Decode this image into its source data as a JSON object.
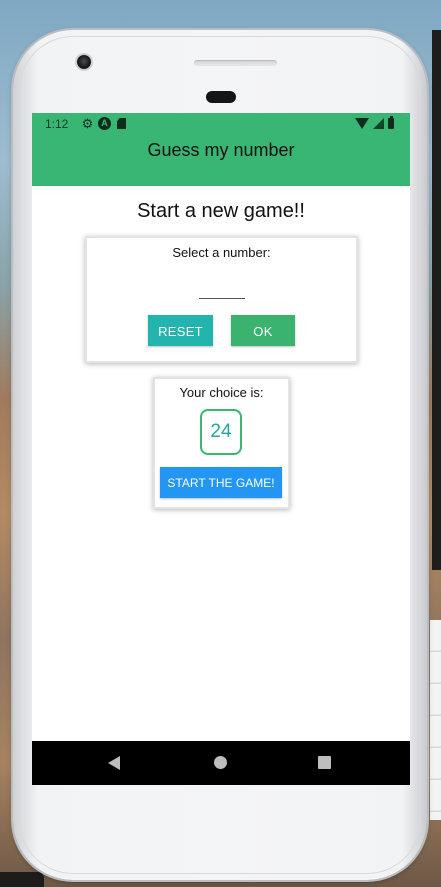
{
  "status_bar": {
    "time": "1:12",
    "icons_left": [
      "gear-icon",
      "a-circle-icon",
      "sd-card-icon"
    ],
    "icons_right": [
      "wifi-icon",
      "cell-signal-icon",
      "battery-icon"
    ]
  },
  "header": {
    "title": "Guess my number",
    "color": "#3ab674"
  },
  "main": {
    "title": "Start a new game!!",
    "input_card": {
      "label": "Select a number:",
      "input_value": "",
      "input_placeholder": "",
      "reset_label": "RESET",
      "ok_label": "OK",
      "reset_color": "#23b5ad",
      "ok_color": "#39b36f"
    },
    "choice_card": {
      "label": "Your choice is:",
      "number": "24",
      "start_label": "START THE GAME!",
      "start_color": "#2396f3"
    }
  },
  "nav_bar": {
    "buttons": [
      "back-icon",
      "home-icon",
      "recents-icon"
    ]
  }
}
